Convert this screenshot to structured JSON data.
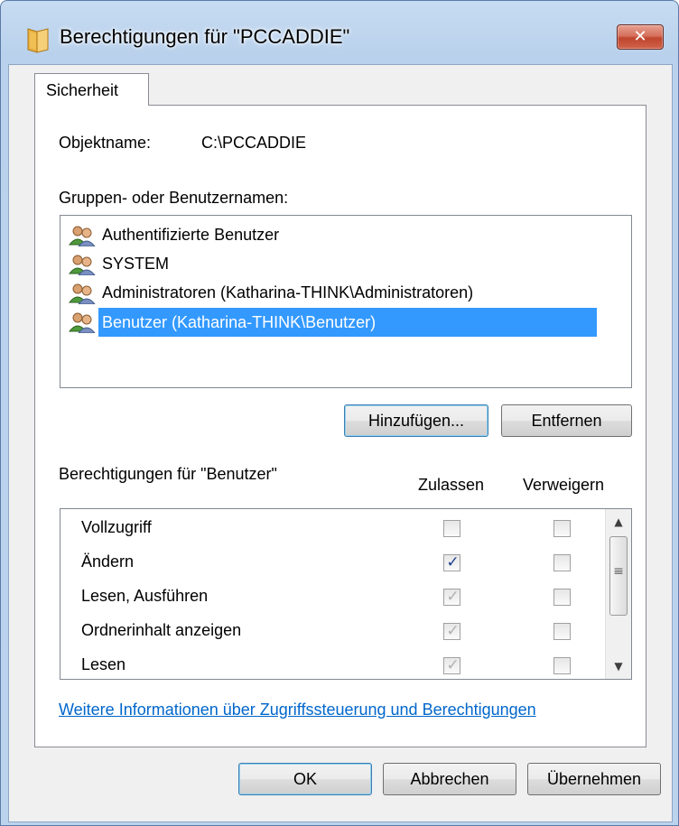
{
  "window": {
    "title": "Berechtigungen für \"PCCADDIE\"",
    "close_label": "✕"
  },
  "tabs": [
    {
      "label": "Sicherheit",
      "active": true
    }
  ],
  "object": {
    "label": "Objektname:",
    "value": "C:\\PCCADDIE"
  },
  "groups": {
    "label": "Gruppen- oder Benutzernamen:",
    "items": [
      {
        "label": "Authentifizierte Benutzer",
        "selected": false
      },
      {
        "label": "SYSTEM",
        "selected": false
      },
      {
        "label": "Administratoren (Katharina-THINK\\Administratoren)",
        "selected": false
      },
      {
        "label": "Benutzer (Katharina-THINK\\Benutzer)",
        "selected": true
      }
    ],
    "add_label": "Hinzufügen...",
    "remove_label": "Entfernen"
  },
  "permissions": {
    "label": "Berechtigungen für \"Benutzer\"",
    "col_allow": "Zulassen",
    "col_deny": "Verweigern",
    "rows": [
      {
        "label": "Vollzugriff",
        "allow": "unchecked",
        "deny": "unchecked"
      },
      {
        "label": "Ändern",
        "allow": "checked",
        "deny": "unchecked"
      },
      {
        "label": "Lesen, Ausführen",
        "allow": "inherited",
        "deny": "unchecked"
      },
      {
        "label": "Ordnerinhalt anzeigen",
        "allow": "inherited",
        "deny": "unchecked"
      },
      {
        "label": "Lesen",
        "allow": "inherited",
        "deny": "unchecked"
      }
    ]
  },
  "link": {
    "label": "Weitere Informationen über Zugriffssteuerung und Berechtigungen"
  },
  "footer": {
    "ok_label": "OK",
    "cancel_label": "Abbrechen",
    "apply_label": "Übernehmen"
  },
  "colors": {
    "selection": "#3399ff",
    "link": "#0066cc",
    "close_button": "#c0452e"
  }
}
